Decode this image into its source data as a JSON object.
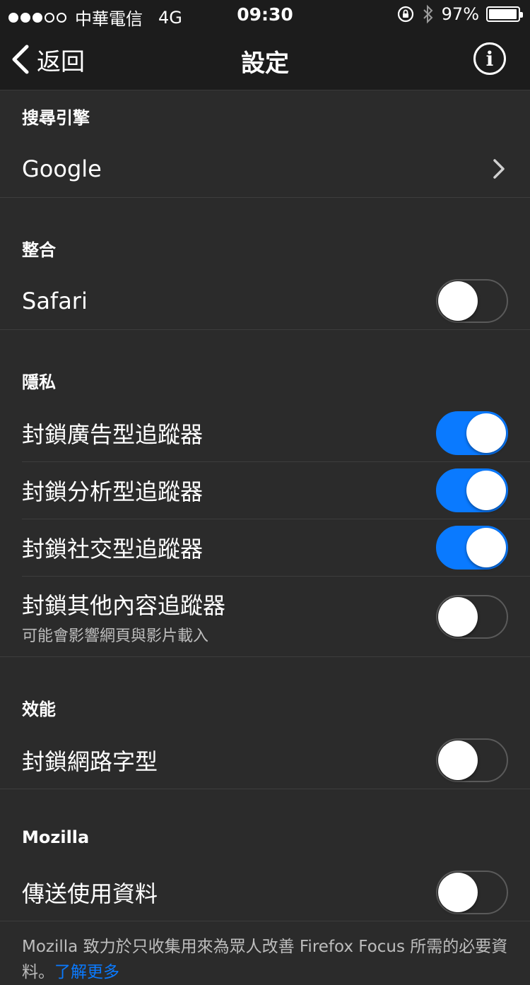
{
  "status_bar": {
    "carrier": "中華電信",
    "network": "4G",
    "time": "09:30",
    "battery": "97%",
    "battery_level": 0.97
  },
  "nav": {
    "back_label": "返回",
    "title": "設定"
  },
  "sections": {
    "search": {
      "header": "搜尋引擎",
      "engine": "Google"
    },
    "integration": {
      "header": "整合",
      "safari_label": "Safari",
      "safari_on": false
    },
    "privacy": {
      "header": "隱私",
      "rows": [
        {
          "label": "封鎖廣告型追蹤器",
          "on": true
        },
        {
          "label": "封鎖分析型追蹤器",
          "on": true
        },
        {
          "label": "封鎖社交型追蹤器",
          "on": true
        },
        {
          "label": "封鎖其他內容追蹤器",
          "sub": "可能會影響網頁與影片載入",
          "on": false
        }
      ]
    },
    "performance": {
      "header": "效能",
      "row_label": "封鎖網路字型",
      "on": false
    },
    "mozilla": {
      "header": "Mozilla",
      "row_label": "傳送使用資料",
      "on": false
    }
  },
  "footer": {
    "text": "Mozilla 致力於只收集用來為眾人改善 Firefox Focus 所需的必要資料。",
    "link": "了解更多"
  },
  "colors": {
    "background": "#2b2b2b",
    "bar": "#1c1c1c",
    "accent": "#0a7aff"
  }
}
